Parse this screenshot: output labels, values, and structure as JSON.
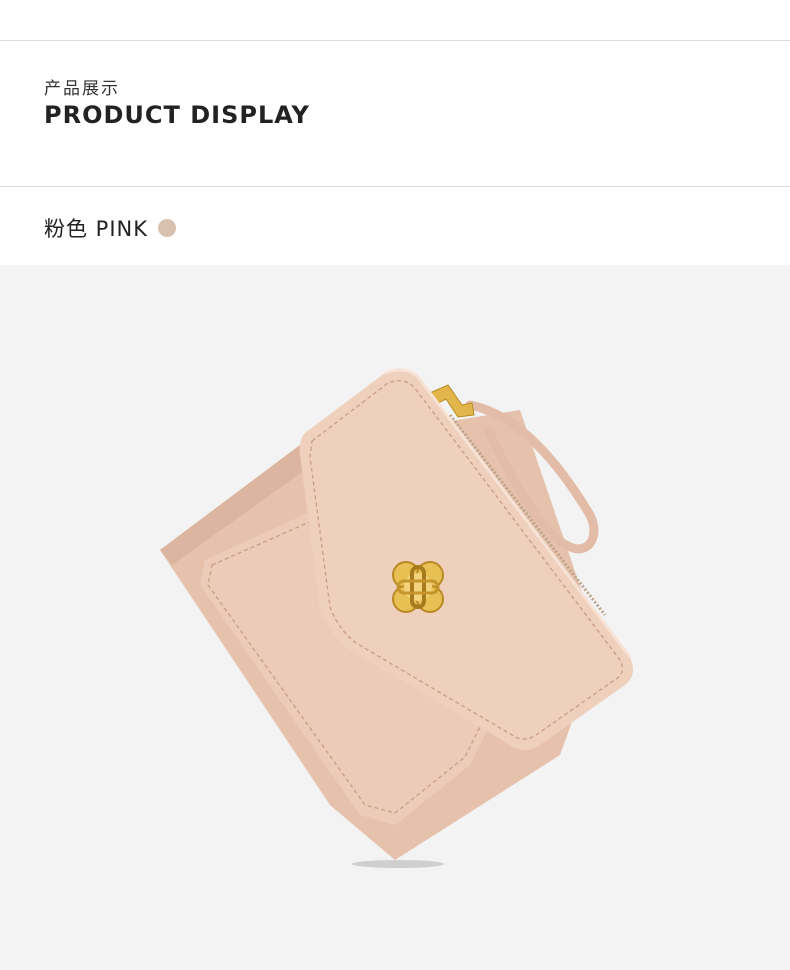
{
  "section": {
    "subtitle_cn": "产品展示",
    "title_en": "PRODUCT DISPLAY"
  },
  "color_option": {
    "label": "粉色 PINK",
    "swatch_color": "#d9c1b0"
  },
  "product_image": {
    "icon": "wallet-icon",
    "colors": {
      "leather": "#e8c6b2",
      "leather_shadow": "#d9b39c",
      "leather_light": "#f1d7c6",
      "stitch": "#c99c84",
      "gold": "#e2b64a",
      "gold_dark": "#b88a25",
      "background": "#f3f3f3"
    }
  }
}
